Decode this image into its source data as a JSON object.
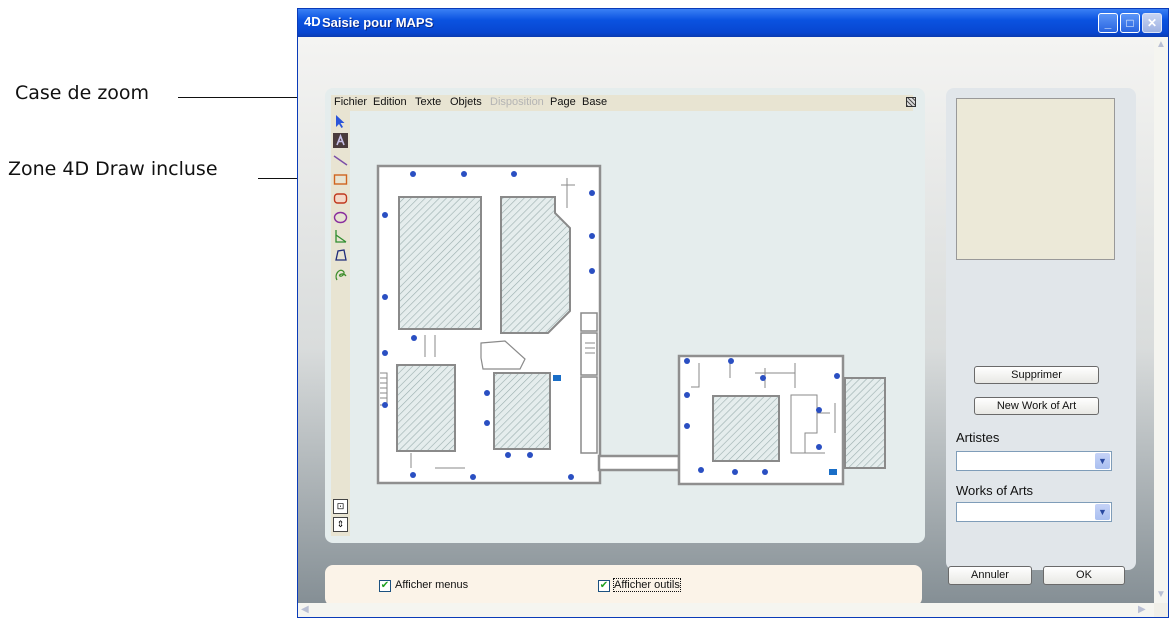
{
  "annotations": {
    "zoom_box": "Case de zoom",
    "draw_area": "Zone 4D Draw incluse"
  },
  "window": {
    "logo": "4D",
    "title": "Saisie pour  MAPS",
    "controls": [
      "minimize",
      "maximize",
      "close"
    ]
  },
  "draw_menu": {
    "items": [
      "Fichier",
      "Edition",
      "Texte",
      "Objets",
      "Disposition",
      "Page",
      "Base"
    ],
    "disabled": [
      "Disposition"
    ]
  },
  "draw_tools": [
    "arrow-tool-icon",
    "text-tool-icon",
    "line-tool-icon",
    "rectangle-tool-icon",
    "rounded-rectangle-tool-icon",
    "oval-tool-icon",
    "polyline-tool-icon",
    "polygon-tool-icon",
    "freehand-tool-icon"
  ],
  "side_panel": {
    "delete_label": "Supprimer",
    "new_label": "New Work of Art",
    "artists_label": "Artistes",
    "artists_value": "",
    "works_label": "Works of Arts",
    "works_value": ""
  },
  "options": {
    "show_menus_label": "Afficher menus",
    "show_menus_checked": true,
    "show_tools_label": "Afficher outils",
    "show_tools_checked": true
  },
  "footer": {
    "cancel_label": "Annuler",
    "ok_label": "OK"
  },
  "colors": {
    "titlebar": "#0a52e0",
    "panel_bg": "#e5eded",
    "menu_bg": "#e8e4d2",
    "marker": "#2a4fc2",
    "hatch": "#9aaeae"
  }
}
